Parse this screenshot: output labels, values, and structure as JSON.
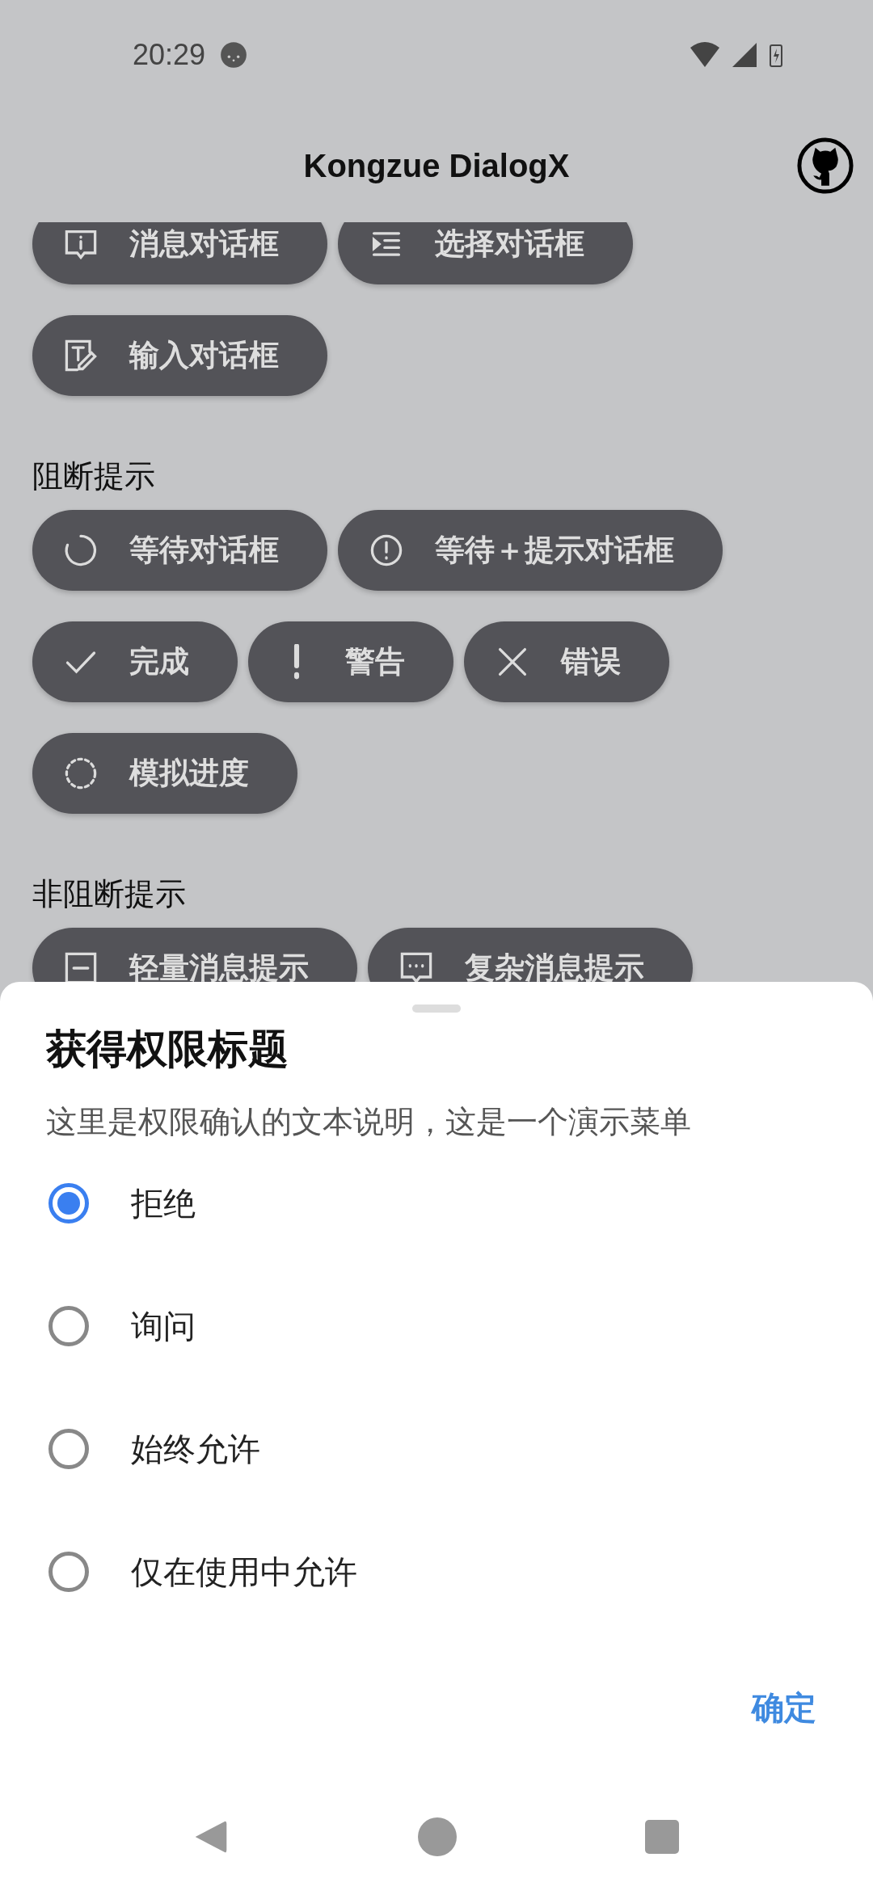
{
  "status_bar": {
    "time": "20:29"
  },
  "app_bar": {
    "title": "Kongzue DialogX"
  },
  "groups": [
    {
      "rows": [
        {
          "buttons": [
            "消息对话框",
            "选择对话框"
          ]
        },
        {
          "buttons": [
            "输入对话框"
          ]
        }
      ]
    },
    {
      "heading": "阻断提示",
      "rows": [
        {
          "buttons": [
            "等待对话框",
            "等待＋提示对话框"
          ]
        },
        {
          "buttons": [
            "完成",
            "警告",
            "错误"
          ]
        },
        {
          "buttons": [
            "模拟进度"
          ]
        }
      ]
    },
    {
      "heading": "非阻断提示",
      "rows": [
        {
          "buttons": [
            "轻量消息提示",
            "复杂消息提示"
          ]
        }
      ]
    }
  ],
  "sheet": {
    "title": "获得权限标题",
    "description": "这里是权限确认的文本说明，这是一个演示菜单",
    "options": [
      {
        "label": "拒绝",
        "selected": true
      },
      {
        "label": "询问",
        "selected": false
      },
      {
        "label": "始终允许",
        "selected": false
      },
      {
        "label": "仅在使用中允许",
        "selected": false
      }
    ],
    "button": "确定"
  }
}
